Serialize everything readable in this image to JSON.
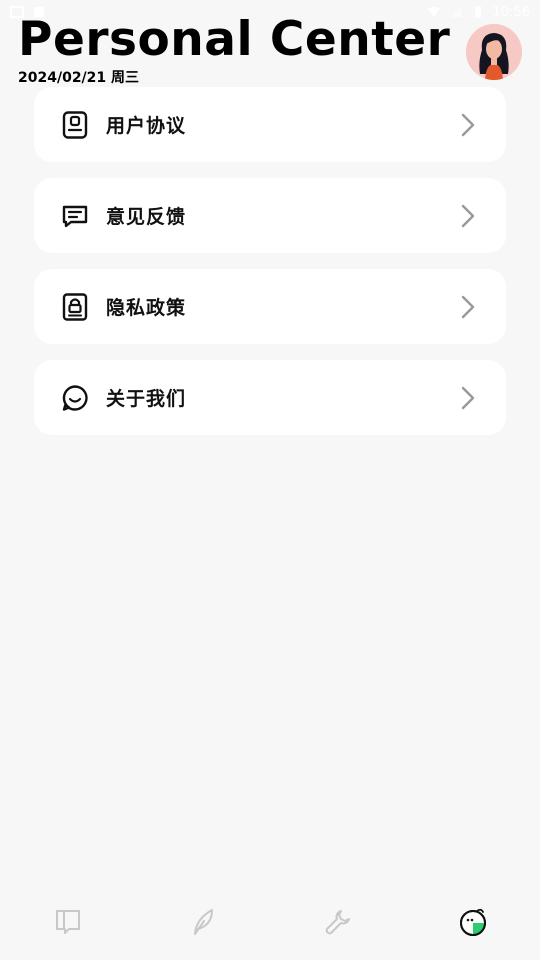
{
  "status_bar": {
    "time": "10:56"
  },
  "header": {
    "title": "Personal Center",
    "date": "2024/02/21 周三"
  },
  "menu": [
    {
      "label": "用户协议",
      "icon": "user-agreement-icon"
    },
    {
      "label": "意见反馈",
      "icon": "feedback-icon"
    },
    {
      "label": "隐私政策",
      "icon": "privacy-policy-icon"
    },
    {
      "label": "关于我们",
      "icon": "about-us-icon"
    }
  ],
  "bottom_nav": [
    {
      "icon": "notebook-icon",
      "active": false
    },
    {
      "icon": "feather-icon",
      "active": false
    },
    {
      "icon": "wrench-icon",
      "active": false
    },
    {
      "icon": "profile-face-icon",
      "active": true
    }
  ],
  "colors": {
    "background": "#f7f7f7",
    "card": "#ffffff",
    "inactive_icon": "#c8c8c8",
    "active_accent": "#2ecc71"
  }
}
